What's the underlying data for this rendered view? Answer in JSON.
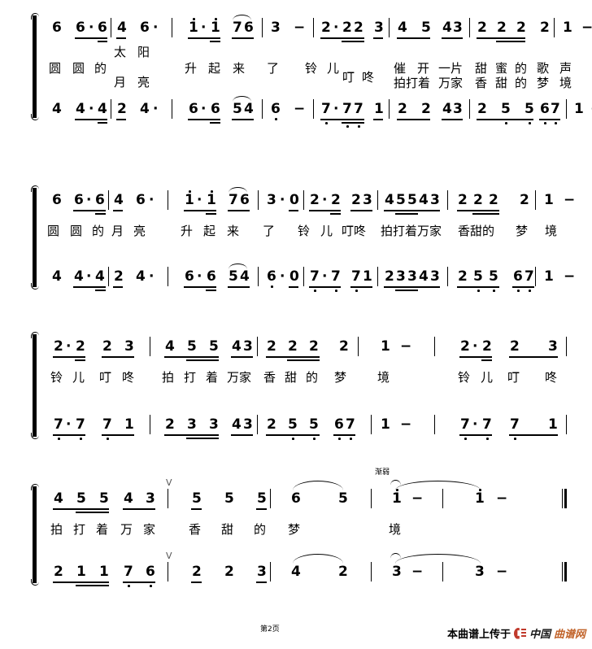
{
  "document": {
    "type": "jianpu-sheet-music",
    "language": "zh-CN",
    "page_label": "第2页"
  },
  "footer": {
    "page_label": "第2页",
    "credit_prefix": "本曲谱上传于",
    "logo_black": "中国",
    "logo_orange": "曲谱网"
  },
  "markings": {
    "breath": "V",
    "diminuendo": "渐弱"
  },
  "systems": [
    {
      "id": "system-1",
      "melody": "6 6·6 | 4 6· | 1·1 76 | 3 − | 2·22 3 | 4 5 43 | 2 2 2 2 | 1 − :||",
      "harmony": "4 4·4 | 2 4· | 6·6 54 | 6 − | 7·77 1 | 2 2 43 | 2 5 5 67 | 1 − :||",
      "lyrics_upper": "太 阳",
      "lyrics_main": "圆 圆 的 月 亮 升 起 来 了 铃 儿 叮 咚 催 开 一 片 甜 蜜 的 歌 声",
      "lyrics_lower": "拍 打 着 万 家 香 甜 的 梦 境",
      "melody_notes": [
        {
          "t": "6"
        },
        {
          "t": "6"
        },
        {
          "t": "·"
        },
        {
          "t": "6"
        },
        {
          "t": "4"
        },
        {
          "t": "6"
        },
        {
          "t": "·"
        },
        {
          "t": "1"
        },
        {
          "t": "·"
        },
        {
          "t": "1"
        },
        {
          "t": "7"
        },
        {
          "t": "6"
        },
        {
          "t": "3"
        },
        {
          "t": "−"
        },
        {
          "t": "2"
        },
        {
          "t": "·"
        },
        {
          "t": "2"
        },
        {
          "t": "2"
        },
        {
          "t": "3"
        },
        {
          "t": "4"
        },
        {
          "t": "5"
        },
        {
          "t": "4"
        },
        {
          "t": "3"
        },
        {
          "t": "2"
        },
        {
          "t": "2"
        },
        {
          "t": "2"
        },
        {
          "t": "2"
        },
        {
          "t": "1"
        },
        {
          "t": "−"
        }
      ],
      "harmony_notes": [
        {
          "t": "4"
        },
        {
          "t": "4"
        },
        {
          "t": "·"
        },
        {
          "t": "4"
        },
        {
          "t": "2"
        },
        {
          "t": "4"
        },
        {
          "t": "·"
        },
        {
          "t": "6"
        },
        {
          "t": "·"
        },
        {
          "t": "6"
        },
        {
          "t": "5"
        },
        {
          "t": "4"
        },
        {
          "t": "6"
        },
        {
          "t": "−"
        },
        {
          "t": "7"
        },
        {
          "t": "·"
        },
        {
          "t": "7"
        },
        {
          "t": "7"
        },
        {
          "t": "1"
        },
        {
          "t": "2"
        },
        {
          "t": "2"
        },
        {
          "t": "4"
        },
        {
          "t": "3"
        },
        {
          "t": "2"
        },
        {
          "t": "5"
        },
        {
          "t": "5"
        },
        {
          "t": "6"
        },
        {
          "t": "7"
        },
        {
          "t": "1"
        },
        {
          "t": "−"
        }
      ]
    },
    {
      "id": "system-2",
      "melody": "6 6·6 | 4 6· | 1·1 76 | 3·0 | 2·2 23 | 45543 | 222 2 | 1 − |",
      "harmony": "4 4·4 | 2 4· | 6·6 54 | 6·0 | 7·7 71 | 23343 | 255 67 | 1 − |",
      "lyrics_main": "圆 圆 的 月 亮 升 起 来 了 铃 儿 叮咚 拍打着万家 香甜的 梦 境"
    },
    {
      "id": "system-3",
      "melody": "2·2 2 3 | 4 5 5 43 | 2 2 2 2 | 1 − | 2·2 2 3 |",
      "harmony": "7·7 7 1 | 2 3 3 43 | 2 5 5 67 | 1 − | 7·7 7 1 |",
      "lyrics_main": "铃 儿 叮 咚 拍 打 着 万家 香 甜 的 梦 境 铃 儿 叮 咚"
    },
    {
      "id": "system-4",
      "melody": "4 5 5 4 3 V | 5 5 5 | 6 5 | 1 − | 1 − ||",
      "harmony": "2 1 1 7 6 V | 2 2 3 | 4 2 | 3 − | 3 − ||",
      "lyrics_main": "拍 打 着 万 家 香 甜 的 梦 境"
    }
  ]
}
